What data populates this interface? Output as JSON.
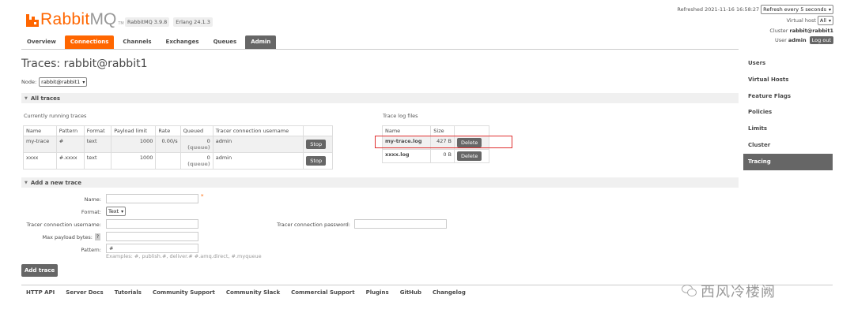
{
  "header": {
    "logo_rabbit": "Rabbit",
    "logo_mq": "MQ",
    "logo_tm": "TM",
    "rabbitmq_version": "RabbitMQ 3.9.8",
    "erlang_version": "Erlang 24.1.3",
    "refreshed_text": "Refreshed 2021-11-16 16:58:27",
    "refresh_select": "Refresh every 5 seconds",
    "vhost_label": "Virtual host",
    "vhost_select": "All",
    "cluster_label": "Cluster",
    "cluster_value": "rabbit@rabbit1",
    "user_label": "User",
    "user_value": "admin",
    "logout_label": "Log out"
  },
  "tabs": [
    {
      "label": "Overview"
    },
    {
      "label": "Connections"
    },
    {
      "label": "Channels"
    },
    {
      "label": "Exchanges"
    },
    {
      "label": "Queues"
    },
    {
      "label": "Admin"
    }
  ],
  "sidebar": {
    "items": [
      {
        "label": "Users"
      },
      {
        "label": "Virtual Hosts"
      },
      {
        "label": "Feature Flags"
      },
      {
        "label": "Policies"
      },
      {
        "label": "Limits"
      },
      {
        "label": "Cluster"
      },
      {
        "label": "Tracing"
      }
    ]
  },
  "main": {
    "title": "Traces: rabbit@rabbit1",
    "node_label": "Node:",
    "node_select": "rabbit@rabbit1",
    "all_traces_label": "All traces",
    "running_traces_label": "Currently running traces",
    "trace_columns": [
      "Name",
      "Pattern",
      "Format",
      "Payload limit",
      "Rate",
      "Queued",
      "Tracer connection username"
    ],
    "traces": [
      {
        "name": "my-trace",
        "pattern": "#",
        "format": "text",
        "payload_limit": "1000",
        "rate": "0.00/s",
        "queued": "0",
        "queued_sub": "(queue)",
        "username": "admin",
        "action": "Stop"
      },
      {
        "name": "xxxx",
        "pattern": "#.xxxx",
        "format": "text",
        "payload_limit": "1000",
        "rate": "",
        "queued": "0",
        "queued_sub": "(queue)",
        "username": "admin",
        "action": "Stop"
      }
    ],
    "log_files_label": "Trace log files",
    "log_columns": [
      "Name",
      "Size"
    ],
    "log_files": [
      {
        "name": "my-trace.log",
        "size": "427 B",
        "action": "Delete"
      },
      {
        "name": "xxxx.log",
        "size": "0 B",
        "action": "Delete"
      }
    ],
    "add_trace_label": "Add a new trace",
    "form": {
      "name_label": "Name:",
      "name_required": "*",
      "format_label": "Format:",
      "format_value": "Text",
      "username_label": "Tracer connection username:",
      "password_label": "Tracer connection password:",
      "payload_label": "Max payload bytes:",
      "payload_help": "?",
      "pattern_label": "Pattern:",
      "pattern_value": "#",
      "examples": "Examples: #, publish.#, deliver.# #.amq.direct, #.myqueue",
      "submit_label": "Add trace"
    }
  },
  "footer": {
    "links": [
      "HTTP API",
      "Server Docs",
      "Tutorials",
      "Community Support",
      "Community Slack",
      "Commercial Support",
      "Plugins",
      "GitHub",
      "Changelog"
    ]
  },
  "watermark": {
    "text": "西风冷楼阙"
  },
  "colors": {
    "brand": "#ff6600",
    "dark_button": "#666666",
    "highlight": "#e03030"
  }
}
